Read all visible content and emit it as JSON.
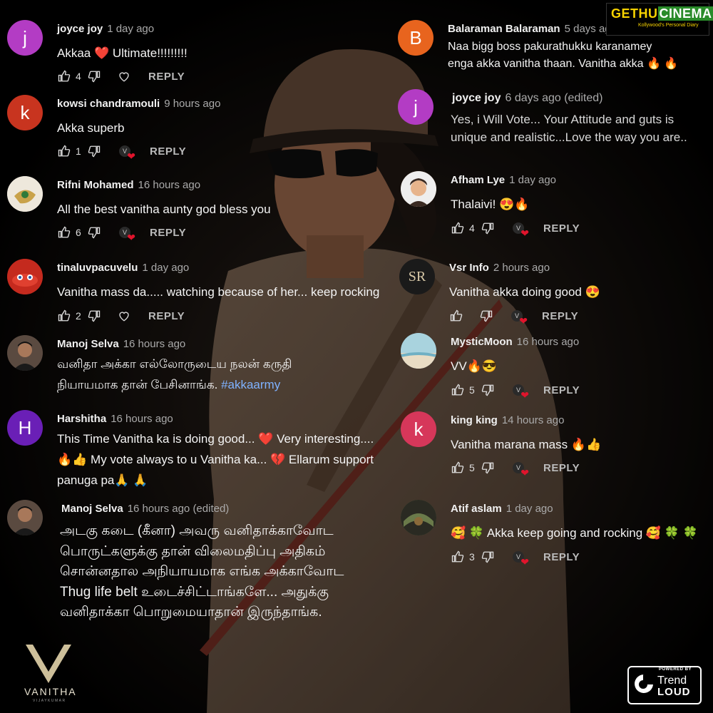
{
  "colors": {
    "background": "#000000",
    "uniform": "#6b5646",
    "heart": "#e0142c",
    "hashtag": "#7fb2ff"
  },
  "watermark": {
    "gethu": "GETHU",
    "cinema": "CINEMA",
    "tagline": "Kollywood's Personal Diary"
  },
  "brand": {
    "name": "VANITHA",
    "sub": "VIJAYKUMAR"
  },
  "powered": {
    "powered_by": "POWERED BY",
    "trend": "Trend",
    "loud": "LOUD"
  },
  "left_comments": [
    {
      "user": "joyce joy",
      "ago": "1 day ago",
      "avatar_letter": "j",
      "avatar_color": "#b33cc4",
      "lines": [
        "Akkaa ❤️  Ultimate!!!!!!!!!"
      ],
      "likes": "4",
      "reply": "REPLY",
      "creator_heart": false
    },
    {
      "user": "kowsi chandramouli",
      "ago": "9 hours ago",
      "avatar_letter": "k",
      "avatar_color": "#c8341f",
      "lines": [
        "Akka superb"
      ],
      "likes": "1",
      "reply": "REPLY",
      "creator_heart": true
    },
    {
      "user": "Rifni Mohamed",
      "ago": "16 hours ago",
      "avatar_letter": "",
      "avatar_color": "#e8e4d8",
      "lines": [
        "All the best vanitha aunty god bless you"
      ],
      "likes": "6",
      "reply": "REPLY",
      "creator_heart": true
    },
    {
      "user": "tinaluvpacuvelu",
      "ago": "1 day ago",
      "avatar_letter": "",
      "avatar_color": "#b62424",
      "lines": [
        "Vanitha mass da..... watching because of her... keep rocking"
      ],
      "likes": "2",
      "reply": "REPLY",
      "creator_heart": false
    },
    {
      "user": "Manoj Selva",
      "ago": "16 hours ago",
      "avatar_letter": "",
      "avatar_color": "#3a3430",
      "lines": [
        "வனிதா அக்கா எல்லோருடைய நலன் கருதி",
        "நியாயமாக தான் பேசினாங்க."
      ],
      "hashtag": "#akkaarmy"
    },
    {
      "user": "Harshitha",
      "ago": "16 hours ago",
      "avatar_letter": "H",
      "avatar_color": "#6a1fb6",
      "lines": [
        "This Time Vanitha ka is doing good... ❤️ Very interesting....",
        "🔥👍 My vote always to u Vanitha ka... 💔 Ellarum support",
        "panuga pa🙏 🙏"
      ]
    },
    {
      "user": "Manoj Selva",
      "ago": "16 hours ago (edited)",
      "avatar_letter": "",
      "avatar_color": "#3a3430",
      "lines": [
        "அடகு கடை (கீனா) அவரு வனிதாக்காவோட",
        "பொருட்களுக்கு தான் விலைமதிப்பு அதிகம்",
        "சொன்னதால அநியாயமாக எங்க அக்காவோட",
        "Thug life belt உடைச்சிட்டாங்களே... அதுக்கு",
        "வனிதாக்கா பொறுமையாதான் இருந்தாங்க."
      ]
    }
  ],
  "right_comments": [
    {
      "user": "Balaraman Balaraman",
      "ago": "5 days ago",
      "avatar_letter": "B",
      "avatar_color": "#e8641e",
      "lines": [
        "Naa bigg boss pakurathukku karanamey",
        "enga akka vanitha thaan. Vanitha akka 🔥 🔥"
      ]
    },
    {
      "user": "joyce joy",
      "ago": "6 days ago (edited)",
      "avatar_letter": "j",
      "avatar_color": "#b33cc4",
      "lines": [
        "Yes, i Will Vote... Your Attitude and guts is",
        "unique and realistic...Love the way you are.."
      ]
    },
    {
      "user": "Afham Lye",
      "ago": "1 day ago",
      "avatar_letter": "",
      "avatar_color": "#d9b99b",
      "lines": [
        "Thalaivi! 😍🔥"
      ],
      "likes": "4",
      "reply": "REPLY",
      "creator_heart": true
    },
    {
      "user": "Vsr Info",
      "ago": "2 hours ago",
      "avatar_letter": "SR",
      "avatar_color": "#1a1a1a",
      "lines": [
        "Vanitha akka doing good 😍"
      ],
      "likes": "",
      "reply": "REPLY",
      "creator_heart": true
    },
    {
      "user": "MysticMoon",
      "ago": "16 hours ago",
      "avatar_letter": "",
      "avatar_color": "#8fb8c8",
      "lines": [
        "VV🔥😎"
      ],
      "likes": "5",
      "reply": "REPLY",
      "creator_heart": true
    },
    {
      "user": "king king",
      "ago": "14 hours ago",
      "avatar_letter": "k",
      "avatar_color": "#d6375a",
      "lines": [
        "Vanitha marana mass 🔥👍"
      ],
      "likes": "5",
      "reply": "REPLY",
      "creator_heart": true
    },
    {
      "user": "Atif aslam",
      "ago": "1 day ago",
      "avatar_letter": "",
      "avatar_color": "#4a5a3a",
      "lines": [
        "🥰 🍀 Akka keep going and rocking 🥰 🍀 🍀"
      ],
      "likes": "3",
      "reply": "REPLY",
      "creator_heart": true
    }
  ]
}
